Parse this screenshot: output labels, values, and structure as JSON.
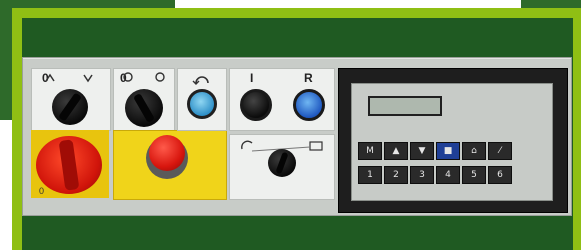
{
  "background": {
    "outer_green": "#2e6a2a",
    "frame_lime": "#8fbf14",
    "inner_green": "#1f5a22",
    "panel_grey": "#c8ccc8"
  },
  "selector_1": {
    "marks": [
      "0",
      ""
    ],
    "icon": "mode-selector-icon"
  },
  "selector_2": {
    "marks": [
      "0",
      ""
    ],
    "icon": "rotation-selector-icon"
  },
  "reset_button": {
    "icon": "rotate-icon"
  },
  "start_button": {
    "mark": "I"
  },
  "reset_r_button": {
    "mark": "R",
    "caption": ""
  },
  "main_switch": {
    "mark": "0"
  },
  "estop": {
    "caption": ""
  },
  "speed_dial": {
    "caption": ""
  },
  "hmi": {
    "lcd_text": "",
    "keys_top": [
      {
        "label": "M",
        "icon": "menu-icon"
      },
      {
        "label": "▲",
        "icon": "arrow-up-icon"
      },
      {
        "label": "▼",
        "icon": "arrow-down-icon"
      },
      {
        "label": "■",
        "icon": "enter-icon"
      },
      {
        "label": "⌂",
        "icon": "home-icon"
      },
      {
        "label": "⁄",
        "icon": "edit-icon"
      }
    ],
    "keys_bottom": [
      "1",
      "2",
      "3",
      "4",
      "5",
      "6"
    ]
  }
}
